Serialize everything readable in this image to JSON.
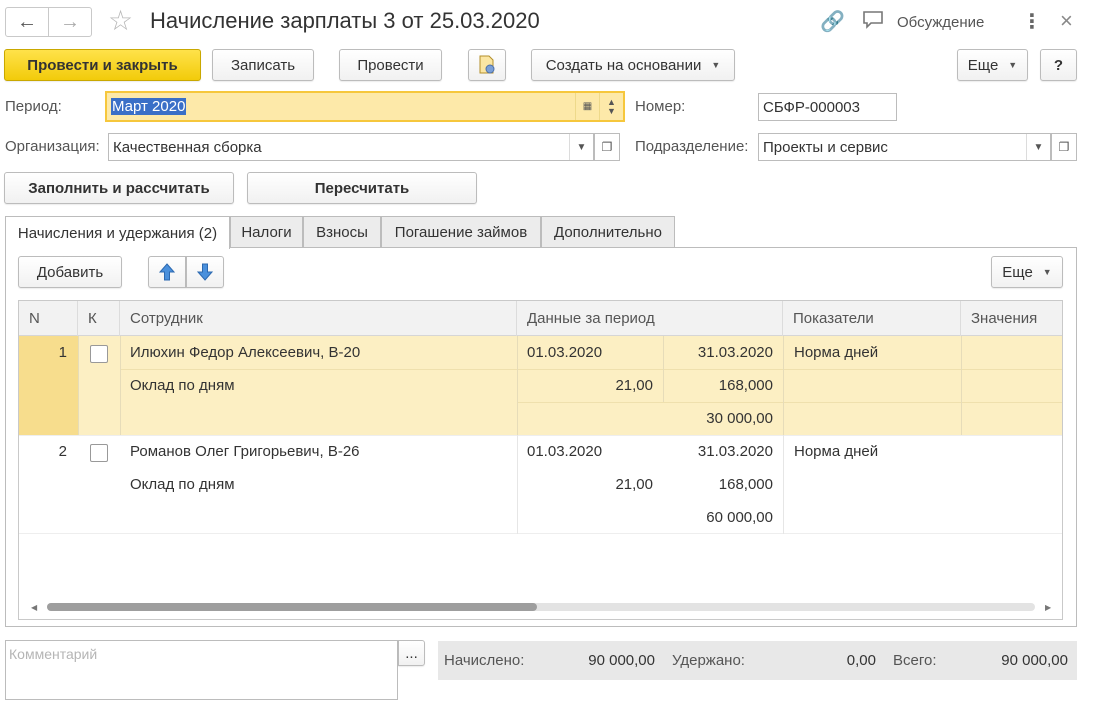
{
  "window": {
    "title": "Начисление зарплаты 3 от 25.03.2020",
    "discussion_label": "Обсуждение"
  },
  "toolbar": {
    "post_and_close": "Провести и закрыть",
    "save": "Записать",
    "post": "Провести",
    "create_based_on": "Создать на основании",
    "more": "Еще",
    "help": "?"
  },
  "form": {
    "period_label": "Период:",
    "period_value": "Март 2020",
    "number_label": "Номер:",
    "number_value": "СБФР-000003",
    "org_label": "Организация:",
    "org_value": "Качественная сборка",
    "dept_label": "Подразделение:",
    "dept_value": "Проекты и сервис",
    "fill_button": "Заполнить и рассчитать",
    "recalc_button": "Пересчитать"
  },
  "tabs": [
    {
      "label": "Начисления и удержания (2)",
      "active": true
    },
    {
      "label": "Налоги",
      "active": false
    },
    {
      "label": "Взносы",
      "active": false
    },
    {
      "label": "Погашение займов",
      "active": false
    },
    {
      "label": "Дополнительно",
      "active": false
    }
  ],
  "table_toolbar": {
    "add": "Добавить",
    "more": "Еще"
  },
  "table": {
    "columns": [
      "N",
      "К",
      "Сотрудник",
      "Данные за период",
      "Показатели",
      "Значения"
    ],
    "rows": [
      {
        "n": "1",
        "employee": "Илюхин Федор Алексеевич, В-20",
        "accrual": "Оклад по дням",
        "date_from": "01.03.2020",
        "date_to": "31.03.2020",
        "days": "21,00",
        "hours": "168,000",
        "amount": "30 000,00",
        "indicator": "Норма дней"
      },
      {
        "n": "2",
        "employee": "Романов Олег Григорьевич, В-26",
        "accrual": "Оклад по дням",
        "date_from": "01.03.2020",
        "date_to": "31.03.2020",
        "days": "21,00",
        "hours": "168,000",
        "amount": "60 000,00",
        "indicator": "Норма дней"
      }
    ]
  },
  "footer": {
    "comment_placeholder": "Комментарий",
    "comment_button": "...",
    "accrued_label": "Начислено:",
    "accrued_value": "90 000,00",
    "withheld_label": "Удержано:",
    "withheld_value": "0,00",
    "total_label": "Всего:",
    "total_value": "90 000,00"
  }
}
